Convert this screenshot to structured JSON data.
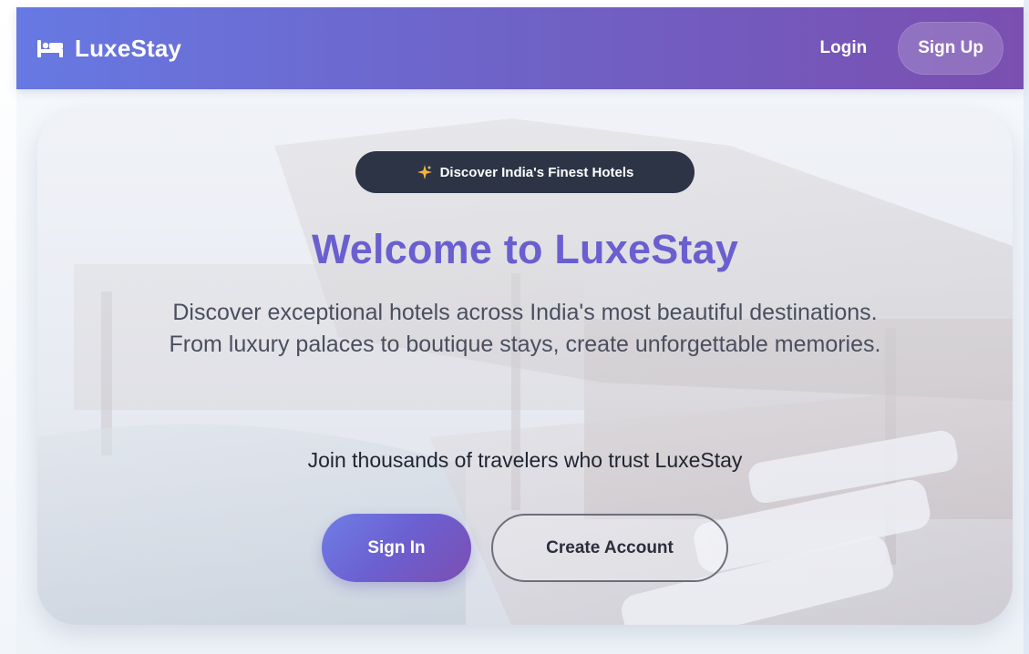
{
  "navbar": {
    "brand": "LuxeStay",
    "brand_icon": "bed-icon",
    "login_label": "Login",
    "signup_label": "Sign Up",
    "gradient_start": "#6779e3",
    "gradient_end": "#7a4fb0"
  },
  "hero": {
    "badge_icon": "sparkle-icon",
    "badge_text": "Discover India's Finest Hotels",
    "title": "Welcome to LuxeStay",
    "description": "Discover exceptional hotels across India's most beautiful destinations. From luxury palaces to boutique stays, create unforgettable memories.",
    "join_text": "Join thousands of travelers who trust LuxeStay",
    "signin_label": "Sign In",
    "create_account_label": "Create Account",
    "title_color": "#6a5fcf",
    "badge_bg": "#2c3446"
  }
}
